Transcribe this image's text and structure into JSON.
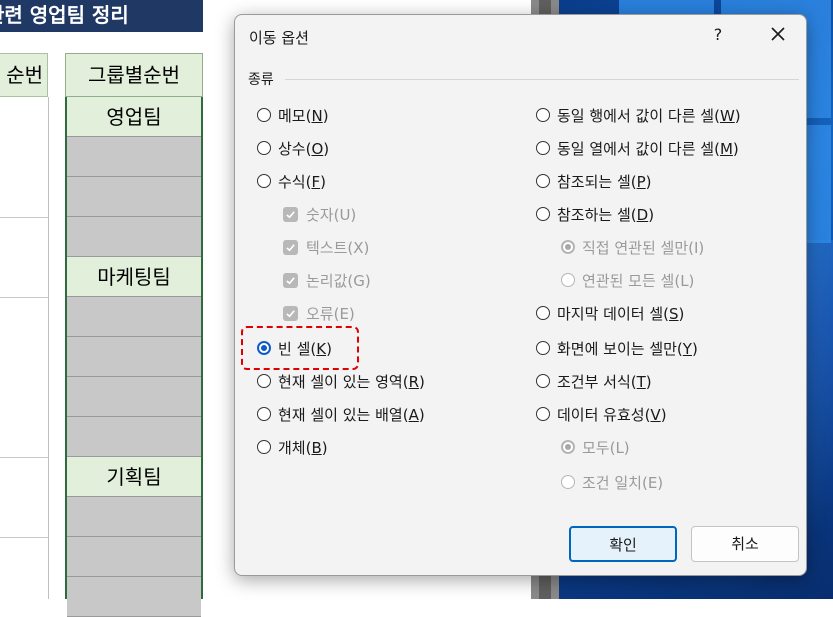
{
  "sheet": {
    "banner_text": "관련 영업팀 정리",
    "col_a_header": "순번",
    "group_header": "그룹별순번",
    "groups": [
      "영업팀",
      "마케팅팀",
      "기획팀"
    ]
  },
  "dialog": {
    "title": "이동 옵션",
    "help": "?",
    "group_label": "종류",
    "left_options": [
      {
        "text": "메모(",
        "key": "N",
        "end": ")"
      },
      {
        "text": "상수(",
        "key": "O",
        "end": ")"
      },
      {
        "text": "수식(",
        "key": "F",
        "end": ")"
      },
      {
        "text": "숫자(U)"
      },
      {
        "text": "텍스트(X)"
      },
      {
        "text": "논리값(G)"
      },
      {
        "text": "오류(E)"
      },
      {
        "text": "빈 셀(",
        "key": "K",
        "end": ")"
      },
      {
        "text": "현재 셀이 있는 영역(",
        "key": "R",
        "end": ")"
      },
      {
        "text": "현재 셀이 있는 배열(",
        "key": "A",
        "end": ")"
      },
      {
        "text": "개체(",
        "key": "B",
        "end": ")"
      }
    ],
    "right_options": [
      {
        "text": "동일 행에서 값이 다른 셀(",
        "key": "W",
        "end": ")"
      },
      {
        "text": "동일 열에서 값이 다른 셀(",
        "key": "M",
        "end": ")"
      },
      {
        "text": "참조되는 셀(",
        "key": "P",
        "end": ")"
      },
      {
        "text": "참조하는 셀(",
        "key": "D",
        "end": ")"
      },
      {
        "text": "직접 연관된 셀만(I)"
      },
      {
        "text": "연관된 모든 셀(L)"
      },
      {
        "text": "마지막 데이터 셀(",
        "key": "S",
        "end": ")"
      },
      {
        "text": "화면에 보이는 셀만(",
        "key": "Y",
        "end": ")"
      },
      {
        "text": "조건부 서식(",
        "key": "T",
        "end": ")"
      },
      {
        "text": "데이터 유효성(",
        "key": "V",
        "end": ")"
      },
      {
        "text": "모두(L)"
      },
      {
        "text": "조건 일치(E)"
      }
    ],
    "selected_option": "빈 셀(K)",
    "ok_label": "확인",
    "cancel_label": "취소"
  },
  "colors": {
    "accent": "#0f5cc7",
    "highlight": "#e00000",
    "header_green": "#e2efda",
    "banner_navy": "#1f3864"
  }
}
